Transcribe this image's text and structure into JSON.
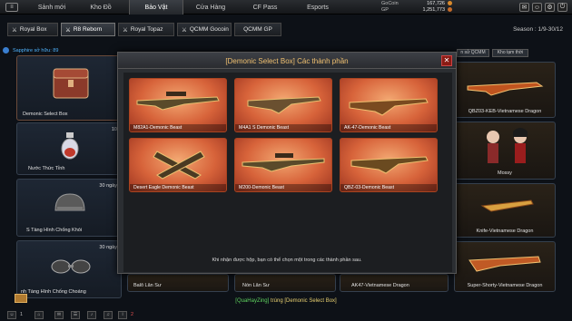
{
  "topnav": {
    "items": [
      "Sảnh mới",
      "Kho Đồ",
      "Bảo Vật",
      "Cửa Hàng",
      "CF Pass",
      "Esports"
    ],
    "active": "Bảo Vật"
  },
  "currency": {
    "gocoin_label": "GoCoin",
    "gocoin_value": "167,726",
    "gp_label": "GP",
    "gp_value": "1,251,773"
  },
  "tabs": [
    "Royal Box",
    "R8 Reborn",
    "Royal Topaz",
    "QCMM Gocoin",
    "QCMM GP"
  ],
  "season": "Season : 1/9-30/12",
  "left": {
    "sapphire": "Sapphire sở hữu: 89",
    "items": [
      {
        "label": "Demonic Select Box",
        "days": ""
      },
      {
        "label": "Nước Thức Tỉnh",
        "days": "10"
      },
      {
        "label": "S Tàng Hình Chống Khói",
        "days": "30 ngày"
      },
      {
        "label": "nh Tàng Hình Chống Choáng",
        "days": "30 ngày"
      }
    ]
  },
  "right_buttons": [
    "n sử QCMM",
    "Kho tạm thời"
  ],
  "right_items": [
    "QBZ03-KEB-Vietnamese Dragon",
    "Mossy",
    "Knife-Vietnamese Dragon",
    "Super-Shorty-Vietnamese Dragon"
  ],
  "bottom_items": [
    "Balô Lân Sư",
    "Nón Lân Sư",
    "AK47-Vietnamese Dragon"
  ],
  "modal": {
    "title": "[Demonic Select Box] Các thành phần",
    "close": "✕",
    "items": [
      "M82A1-Demonic Beast",
      "M4A1 S Demonic Beast",
      "AK-47-Demonic Beast",
      "Desert Eagle Demonic Beast",
      "M200-Demonic Beast",
      "QBZ-03-Demonic Beast"
    ],
    "note": "Khi nhận được hộp, bạn có thể chọn một trong các thành phần sau."
  },
  "chat": {
    "user": "[QuaHayZing]",
    "text": " trúng [Demonic Select Box]"
  },
  "bottombar": {
    "counts": [
      "1",
      "2"
    ]
  },
  "colors": {
    "accent": "#f0c070",
    "card_orange": "#d7633a",
    "link_blue": "#4fb4ff",
    "chat_green": "#5fd35f"
  }
}
